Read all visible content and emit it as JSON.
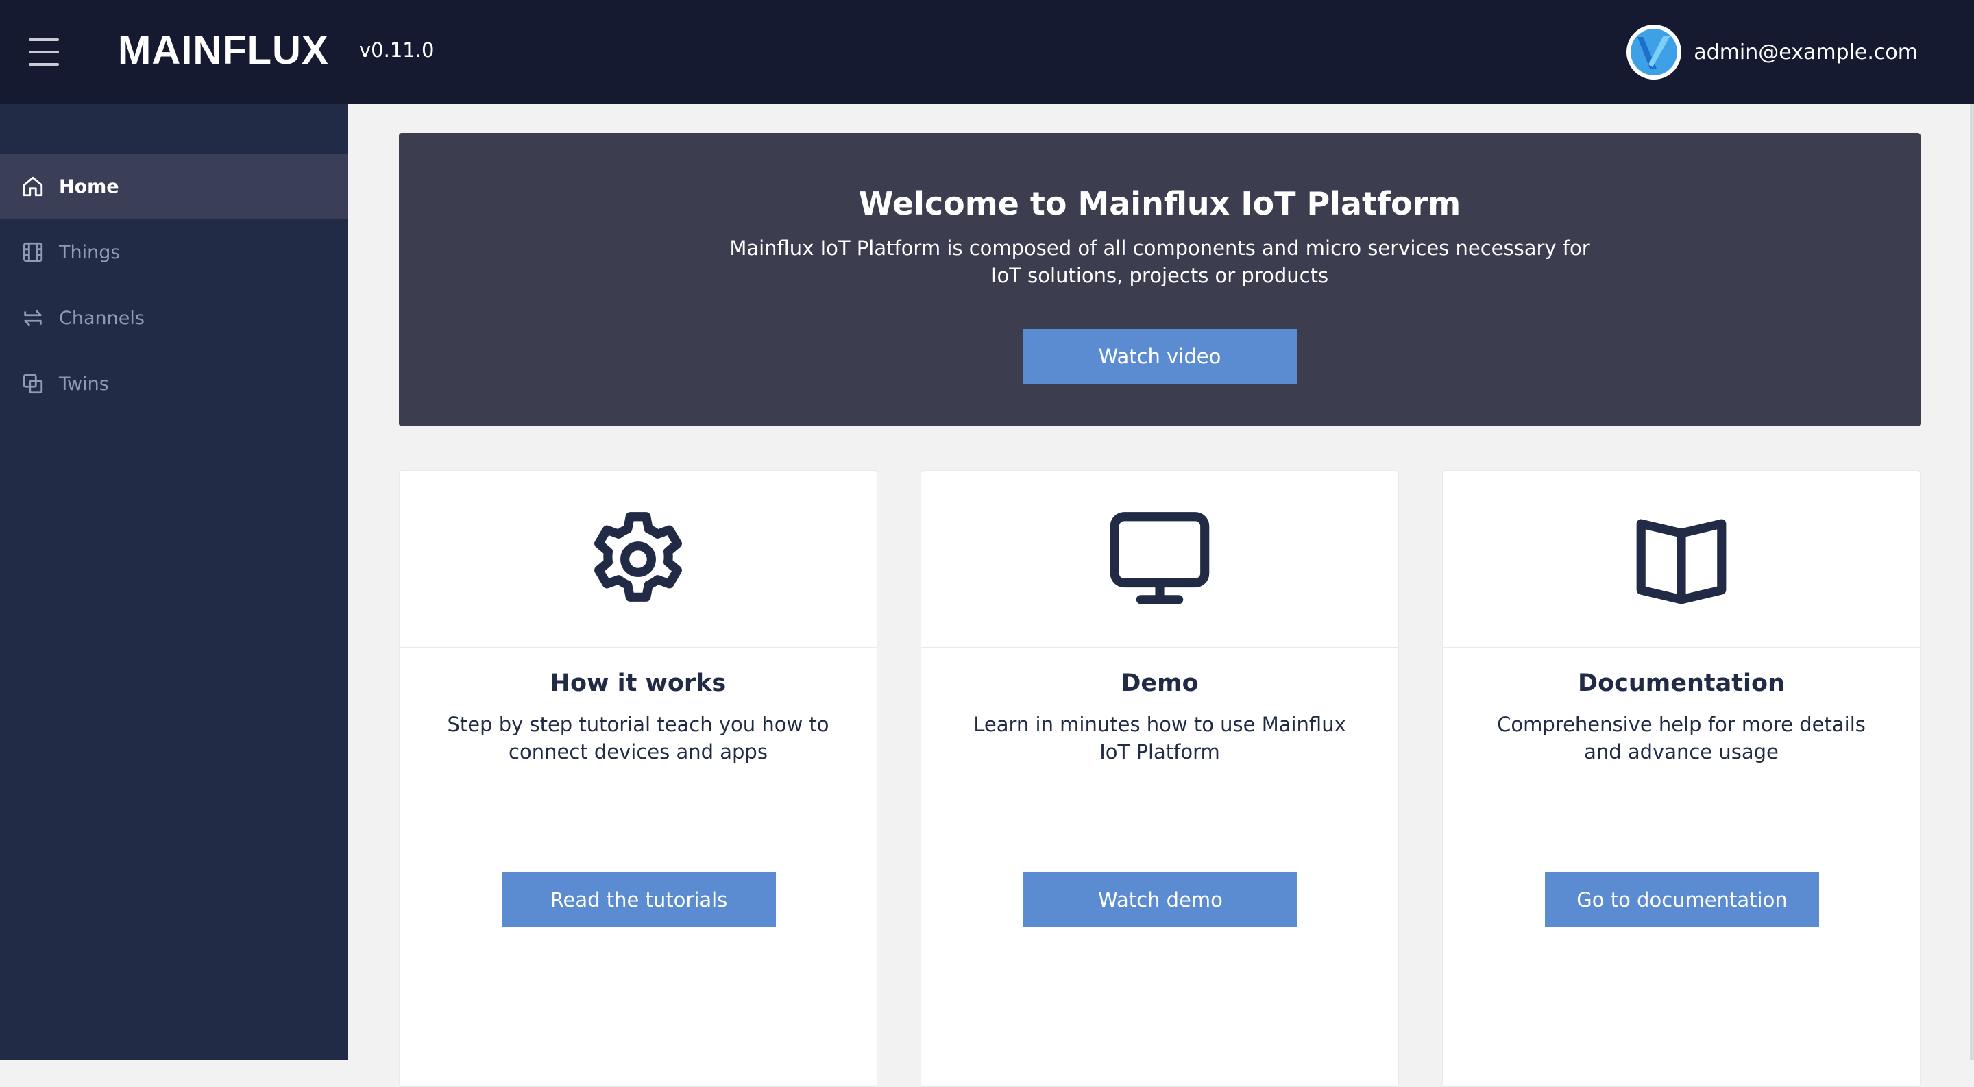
{
  "header": {
    "menu_icon": "hamburger-menu-icon",
    "logo": "MAINFLUX",
    "version": "v0.11.0",
    "user_email": "admin@example.com",
    "avatar_icon": "user-avatar"
  },
  "sidebar": {
    "items": [
      {
        "label": "Home",
        "icon": "home-icon",
        "active": true
      },
      {
        "label": "Things",
        "icon": "film-icon",
        "active": false
      },
      {
        "label": "Channels",
        "icon": "swap-icon",
        "active": false
      },
      {
        "label": "Twins",
        "icon": "copy-icon",
        "active": false
      }
    ]
  },
  "hero": {
    "title": "Welcome to Mainflux IoT Platform",
    "description": "Mainflux IoT Platform is composed of all components and micro services necessary for IoT solutions, projects or products",
    "button": "Watch video"
  },
  "cards": [
    {
      "icon": "gear-icon",
      "title": "How it works",
      "description": "Step by step tutorial teach you how to connect devices and apps",
      "button": "Read the tutorials"
    },
    {
      "icon": "monitor-icon",
      "title": "Demo",
      "description": "Learn in minutes how to use Mainflux IoT Platform",
      "button": "Watch demo"
    },
    {
      "icon": "book-icon",
      "title": "Documentation",
      "description": "Comprehensive help for more details and advance usage",
      "button": "Go to documentation"
    }
  ],
  "colors": {
    "header_bg": "#151a30",
    "sidebar_bg": "#222b45",
    "hero_bg": "#3c3e50",
    "button_bg": "#5b8bd0"
  }
}
